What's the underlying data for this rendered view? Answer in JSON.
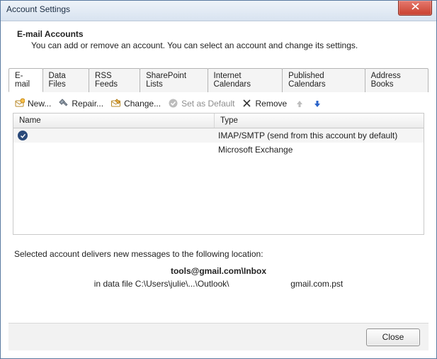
{
  "window": {
    "title": "Account Settings"
  },
  "header": {
    "title": "E-mail Accounts",
    "subtitle": "You can add or remove an account. You can select an account and change its settings."
  },
  "tabs": [
    {
      "label": "E-mail"
    },
    {
      "label": "Data Files"
    },
    {
      "label": "RSS Feeds"
    },
    {
      "label": "SharePoint Lists"
    },
    {
      "label": "Internet Calendars"
    },
    {
      "label": "Published Calendars"
    },
    {
      "label": "Address Books"
    }
  ],
  "toolbar": {
    "new_label": "New...",
    "repair_label": "Repair...",
    "change_label": "Change...",
    "default_label": "Set as Default",
    "remove_label": "Remove"
  },
  "columns": {
    "name": "Name",
    "type": "Type"
  },
  "accounts": [
    {
      "name": "",
      "type": "IMAP/SMTP (send from this account by default)",
      "is_default": true
    },
    {
      "name": "",
      "type": "Microsoft Exchange",
      "is_default": false
    }
  ],
  "delivery": {
    "intro": "Selected account delivers new messages to the following location:",
    "target": "tools@gmail.com\\Inbox",
    "path_prefix": "in data file C:\\Users\\julie\\...\\Outlook\\",
    "path_suffix": "gmail.com.pst"
  },
  "footer": {
    "close_label": "Close"
  }
}
